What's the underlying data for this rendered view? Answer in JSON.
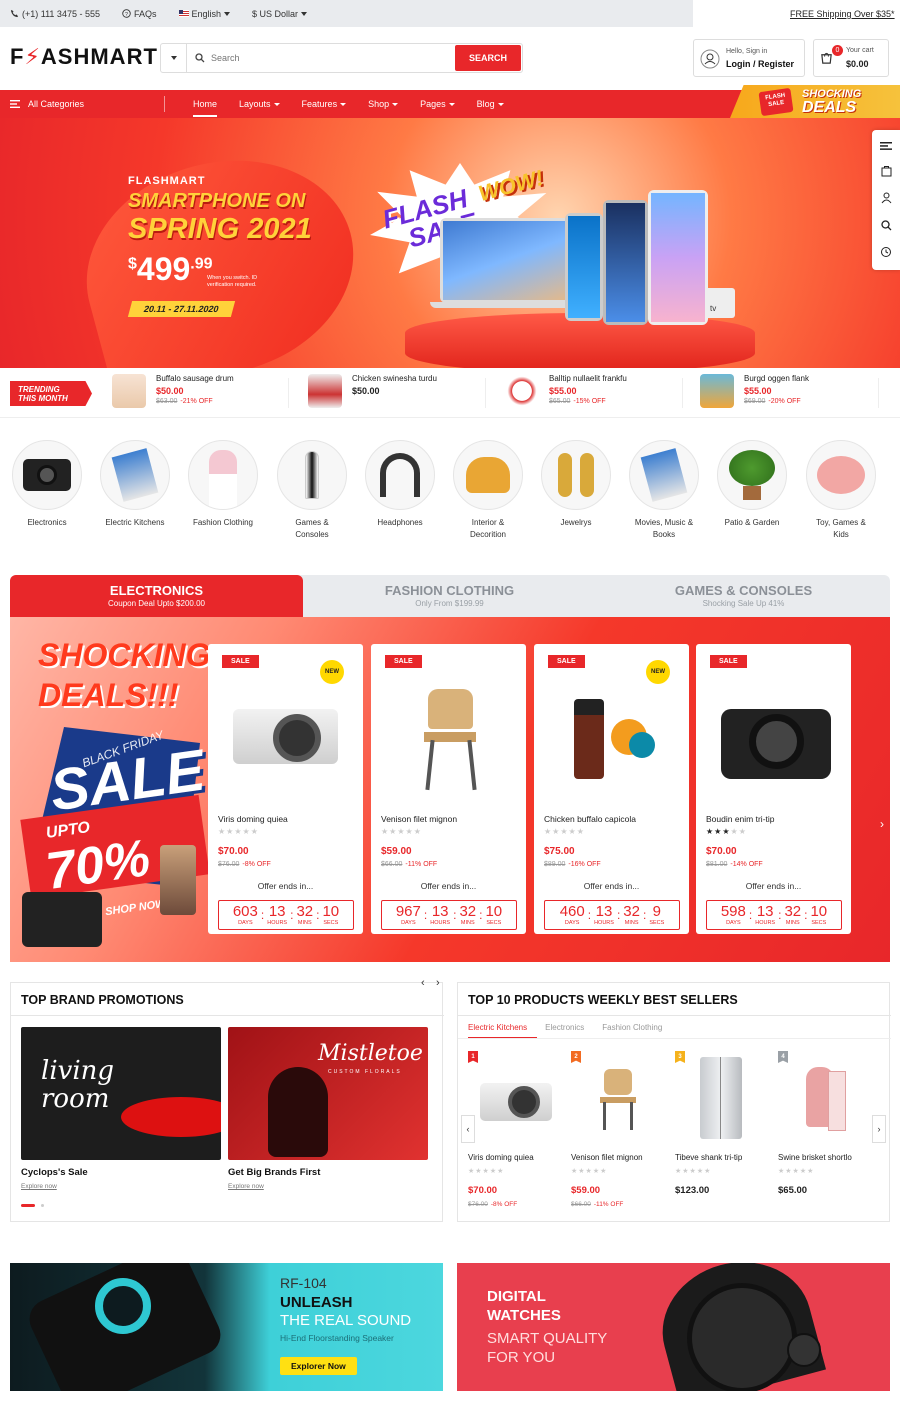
{
  "topbar": {
    "phone": "(+1) 111 3475 - 555",
    "faqs": "FAQs",
    "language": "English",
    "currency": "$ US Dollar",
    "free_shipping": "FREE Shipping Over $35*"
  },
  "header": {
    "logo_prefix": "F",
    "logo_suffix": "ASHMART",
    "search_placeholder": "Search",
    "search_button": "SEARCH",
    "account_greeting": "Hello, Sign in",
    "account_action": "Login / Register",
    "cart_label": "Your cart",
    "cart_total": "$0.00",
    "cart_count": "0"
  },
  "nav": {
    "all_categories": "All Categories",
    "items": [
      "Home",
      "Layouts",
      "Features",
      "Shop",
      "Pages",
      "Blog"
    ],
    "promo_small": "FLASH SALE",
    "promo_line1": "SHOCKING",
    "promo_line2": "DEALS"
  },
  "hero": {
    "brand": "FLASHMART",
    "line1": "SMARTPHONE ON",
    "line2": "SPRING 2021",
    "price_currency": "$",
    "price_main": "499",
    "price_cents": ".99",
    "note": "When you switch. ID verification required.",
    "dates": "20.11 - 27.11.2020",
    "flash_1": "FLASH",
    "flash_2": "SALE",
    "wow": "WOW!",
    "tv_label": "tv"
  },
  "trending": {
    "badge_line1": "TRENDING",
    "badge_line2": "THIS MONTH",
    "items": [
      {
        "name": "Buffalo sausage drum",
        "price": "$50.00",
        "old": "$63.00",
        "off": "-21% OFF"
      },
      {
        "name": "Chicken swinesha turdu",
        "price": "$50.00",
        "old": "",
        "off": ""
      },
      {
        "name": "Balltip nullaelit frankfu",
        "price": "$55.00",
        "old": "$65.00",
        "off": "-15% OFF"
      },
      {
        "name": "Burgd oggen flank",
        "price": "$55.00",
        "old": "$69.00",
        "off": "-20% OFF"
      }
    ]
  },
  "categories": [
    {
      "line1": "Electronics",
      "line2": ""
    },
    {
      "line1": "Electric Kitchens",
      "line2": ""
    },
    {
      "line1": "Fashion Clothing",
      "line2": ""
    },
    {
      "line1": "Games &",
      "line2": "Consoles"
    },
    {
      "line1": "Headphones",
      "line2": ""
    },
    {
      "line1": "Interior &",
      "line2": "Decorition"
    },
    {
      "line1": "Jewelrys",
      "line2": ""
    },
    {
      "line1": "Movies, Music &",
      "line2": "Books"
    },
    {
      "line1": "Patio & Garden",
      "line2": ""
    },
    {
      "line1": "Toy, Games &",
      "line2": "Kids"
    }
  ],
  "deal_tabs": [
    {
      "title": "ELECTRONICS",
      "sub": "Coupon Deal Upto $200.00"
    },
    {
      "title": "FASHION CLOTHING",
      "sub": "Only From $199.99"
    },
    {
      "title": "GAMES & CONSOLES",
      "sub": "Shocking Sale Up 41%"
    }
  ],
  "deals_banner": {
    "line1": "SHOCKING",
    "line2": "DEALS!!!",
    "black_friday": "BLACK FRIDAY",
    "sale": "SALE",
    "upto": "UPTO",
    "percent": "70%",
    "shop_now": "SHOP NOW"
  },
  "deal_cards": [
    {
      "sale": "SALE",
      "new": "NEW",
      "name": "Viris doming quiea",
      "price": "$70.00",
      "old": "$76.00",
      "off": "-8% OFF",
      "rating": 0,
      "offer": "Offer ends in...",
      "days": "603",
      "hours": "13",
      "mins": "32",
      "secs": "10"
    },
    {
      "sale": "SALE",
      "new": "",
      "name": "Venison filet mignon",
      "price": "$59.00",
      "old": "$66.00",
      "off": "-11% OFF",
      "rating": 0,
      "offer": "Offer ends in...",
      "days": "967",
      "hours": "13",
      "mins": "32",
      "secs": "10"
    },
    {
      "sale": "SALE",
      "new": "NEW",
      "name": "Chicken buffalo capicola",
      "price": "$75.00",
      "old": "$89.00",
      "off": "-16% OFF",
      "rating": 0,
      "offer": "Offer ends in...",
      "days": "460",
      "hours": "13",
      "mins": "32",
      "secs": "9"
    },
    {
      "sale": "SALE",
      "new": "",
      "name": "Boudin enim tri-tip",
      "price": "$70.00",
      "old": "$81.00",
      "off": "-14% OFF",
      "rating": 3,
      "offer": "Offer ends in...",
      "days": "598",
      "hours": "13",
      "mins": "32",
      "secs": "10"
    }
  ],
  "timer_labels": {
    "days": "DAYS",
    "hours": "HOURS",
    "mins": "MINS",
    "secs": "SECS"
  },
  "brand_promos": {
    "title": "TOP BRAND PROMOTIONS",
    "items": [
      {
        "title": "Cyclops's Sale",
        "link": "Explore now",
        "art": "living room"
      },
      {
        "title": "Get Big Brands First",
        "link": "Explore now",
        "art": "Mistletoe",
        "art_sub": "CUSTOM FLORALS"
      }
    ]
  },
  "top10": {
    "title": "TOP 10 PRODUCTS WEEKLY BEST SELLERS",
    "tabs": [
      "Electric Kitchens",
      "Electronics",
      "Fashion Clothing"
    ],
    "items": [
      {
        "rank": "1",
        "name": "Viris doming quiea",
        "price": "$70.00",
        "old": "$76.00",
        "off": "-8% OFF",
        "color": "#e8272a"
      },
      {
        "rank": "2",
        "name": "Venison filet mignon",
        "price": "$59.00",
        "old": "$66.00",
        "off": "-11% OFF",
        "color": "#f26b22"
      },
      {
        "rank": "3",
        "name": "Tibeve shank tri-tip",
        "price": "$123.00",
        "old": "",
        "off": "",
        "color": "#f5b21c"
      },
      {
        "rank": "4",
        "name": "Swine brisket shortlo",
        "price": "$65.00",
        "old": "",
        "off": "",
        "color": "#9aa0a6"
      }
    ]
  },
  "banners": [
    {
      "model": "RF-104",
      "line1": "UNLEASH",
      "line2": "THE REAL SOUND",
      "sub": "Hi-End Floorstanding Speaker",
      "button": "Explorer Now"
    },
    {
      "line1": "DIGITAL",
      "line2": "WATCHES",
      "line3": "SMART QUALITY",
      "line4": "FOR YOU"
    }
  ],
  "colors": {
    "accent": "#e8272a",
    "gold": "#ffd23a"
  }
}
